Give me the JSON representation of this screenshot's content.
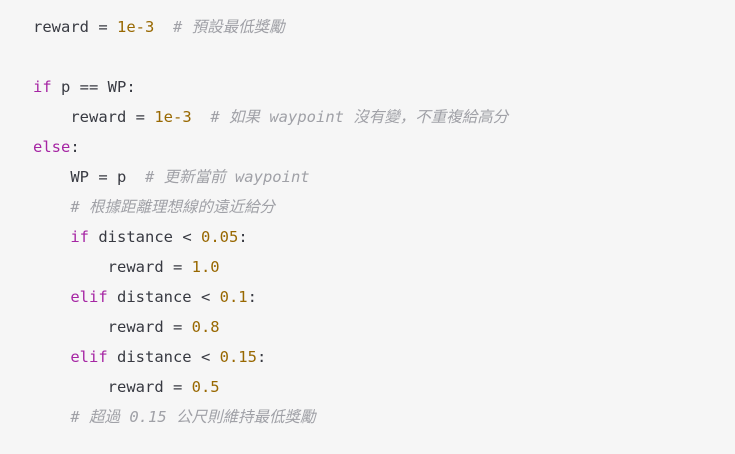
{
  "colors": {
    "background": "#f6f6f6",
    "text": "#383a42",
    "keyword": "#a626a4",
    "number": "#986801",
    "comment": "#a0a1a7"
  },
  "code": {
    "lines": [
      [
        {
          "t": "tx",
          "v": "reward = "
        },
        {
          "t": "num",
          "v": "1e-3"
        },
        {
          "t": "tx",
          "v": "  "
        },
        {
          "t": "cm",
          "v": "# 預設最低獎勵"
        }
      ],
      [],
      [
        {
          "t": "kw",
          "v": "if"
        },
        {
          "t": "tx",
          "v": " p == WP:"
        }
      ],
      [
        {
          "t": "tx",
          "v": "    reward = "
        },
        {
          "t": "num",
          "v": "1e-3"
        },
        {
          "t": "tx",
          "v": "  "
        },
        {
          "t": "cm",
          "v": "# 如果 waypoint 沒有變，不重複給高分"
        }
      ],
      [
        {
          "t": "kw",
          "v": "else"
        },
        {
          "t": "tx",
          "v": ":"
        }
      ],
      [
        {
          "t": "tx",
          "v": "    WP = p  "
        },
        {
          "t": "cm",
          "v": "# 更新當前 waypoint"
        }
      ],
      [
        {
          "t": "tx",
          "v": "    "
        },
        {
          "t": "cm",
          "v": "# 根據距離理想線的遠近給分"
        }
      ],
      [
        {
          "t": "tx",
          "v": "    "
        },
        {
          "t": "kw",
          "v": "if"
        },
        {
          "t": "tx",
          "v": " distance < "
        },
        {
          "t": "num",
          "v": "0.05"
        },
        {
          "t": "tx",
          "v": ":"
        }
      ],
      [
        {
          "t": "tx",
          "v": "        reward = "
        },
        {
          "t": "num",
          "v": "1.0"
        }
      ],
      [
        {
          "t": "tx",
          "v": "    "
        },
        {
          "t": "kw",
          "v": "elif"
        },
        {
          "t": "tx",
          "v": " distance < "
        },
        {
          "t": "num",
          "v": "0.1"
        },
        {
          "t": "tx",
          "v": ":"
        }
      ],
      [
        {
          "t": "tx",
          "v": "        reward = "
        },
        {
          "t": "num",
          "v": "0.8"
        }
      ],
      [
        {
          "t": "tx",
          "v": "    "
        },
        {
          "t": "kw",
          "v": "elif"
        },
        {
          "t": "tx",
          "v": " distance < "
        },
        {
          "t": "num",
          "v": "0.15"
        },
        {
          "t": "tx",
          "v": ":"
        }
      ],
      [
        {
          "t": "tx",
          "v": "        reward = "
        },
        {
          "t": "num",
          "v": "0.5"
        }
      ],
      [
        {
          "t": "tx",
          "v": "    "
        },
        {
          "t": "cm",
          "v": "# 超過 0.15 公尺則維持最低獎勵"
        }
      ]
    ]
  }
}
